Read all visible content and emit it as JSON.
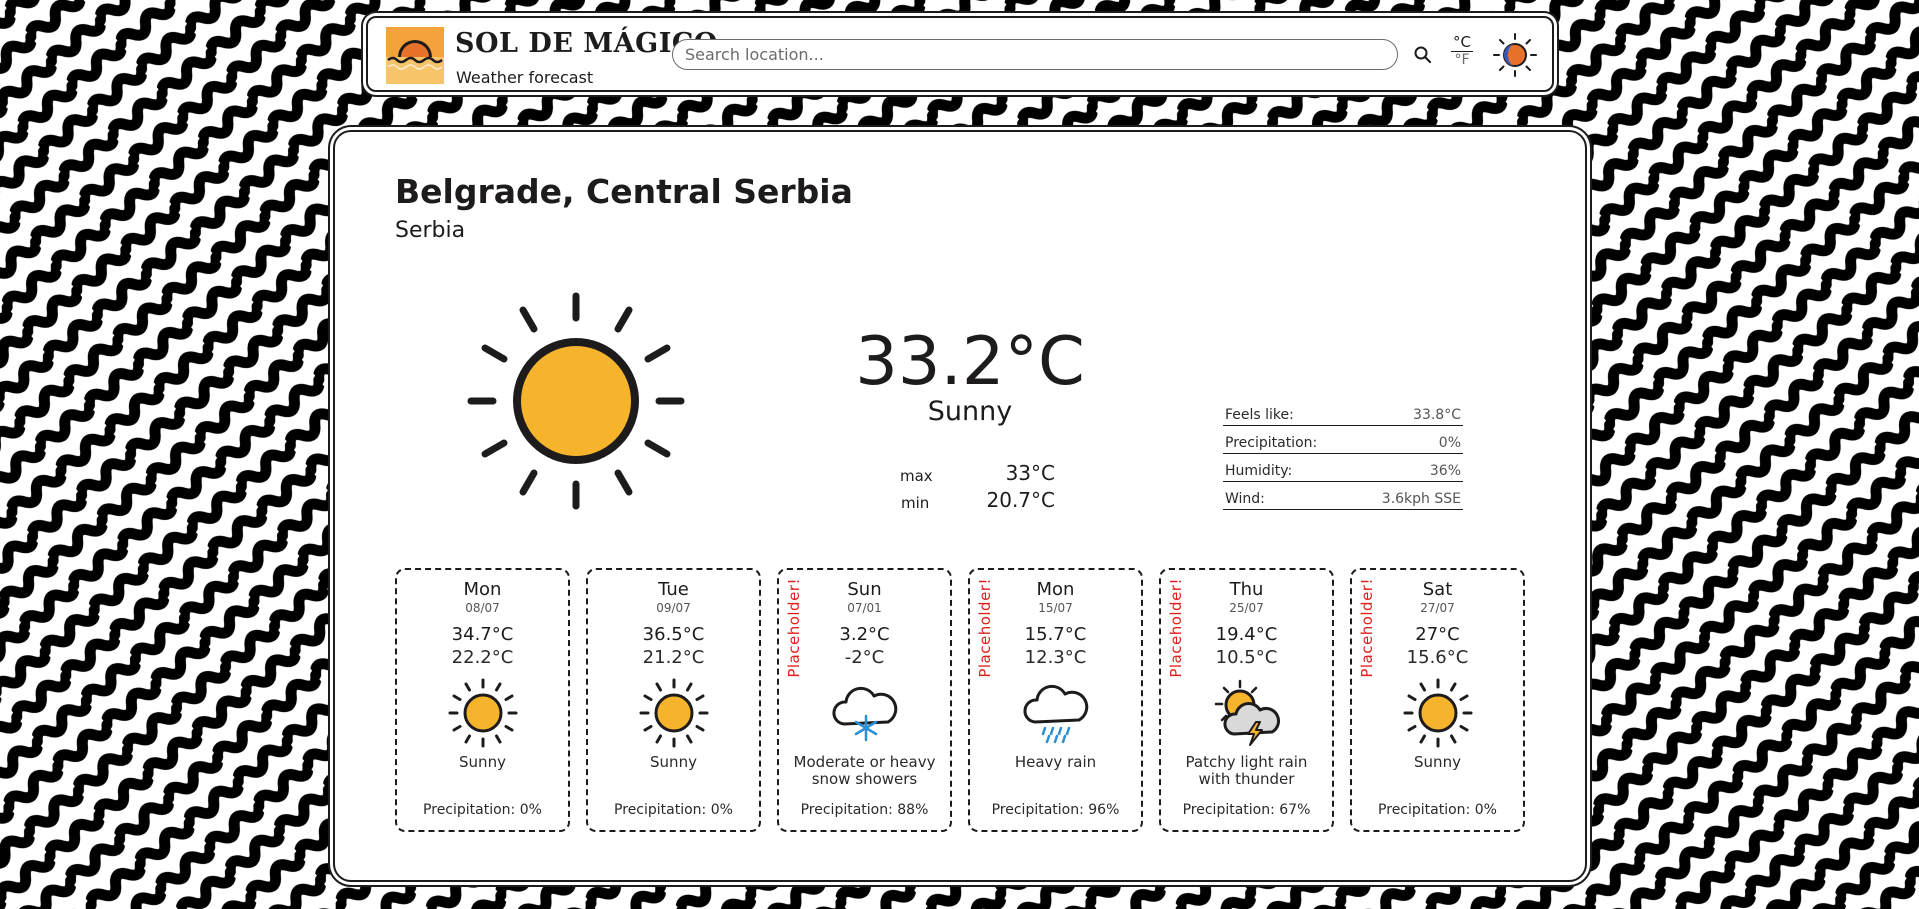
{
  "brand": {
    "title": "SOL DE MÁGICO",
    "subtitle": "Weather forecast"
  },
  "search": {
    "placeholder": "Search location..."
  },
  "units": {
    "celsius": "°C",
    "fahrenheit": "°F"
  },
  "location": {
    "city": "Belgrade, Central Serbia",
    "country": "Serbia"
  },
  "current": {
    "temperature": "33.2°C",
    "condition": "Sunny",
    "icon": "sun-icon",
    "max_label": "max",
    "max": "33°C",
    "min_label": "min",
    "min": "20.7°C"
  },
  "details": [
    {
      "label": "Feels like:",
      "value": "33.8°C"
    },
    {
      "label": "Precipitation:",
      "value": "0%"
    },
    {
      "label": "Humidity:",
      "value": "36%"
    },
    {
      "label": "Wind:",
      "value": "3.6kph SSE"
    }
  ],
  "forecast": [
    {
      "day": "Mon",
      "date": "08/07",
      "max": "34.7°C",
      "min": "22.2°C",
      "condition": "Sunny",
      "icon": "sun-icon",
      "precipitation": "Precipitation: 0%",
      "placeholder": ""
    },
    {
      "day": "Tue",
      "date": "09/07",
      "max": "36.5°C",
      "min": "21.2°C",
      "condition": "Sunny",
      "icon": "sun-icon",
      "precipitation": "Precipitation: 0%",
      "placeholder": ""
    },
    {
      "day": "Sun",
      "date": "07/01",
      "max": "3.2°C",
      "min": "-2°C",
      "condition": "Moderate or heavy snow showers",
      "icon": "snow-cloud-icon",
      "precipitation": "Precipitation: 88%",
      "placeholder": "Placeholder!"
    },
    {
      "day": "Mon",
      "date": "15/07",
      "max": "15.7°C",
      "min": "12.3°C",
      "condition": "Heavy rain",
      "icon": "rain-cloud-icon",
      "precipitation": "Precipitation: 96%",
      "placeholder": "Placeholder!"
    },
    {
      "day": "Thu",
      "date": "25/07",
      "max": "19.4°C",
      "min": "10.5°C",
      "condition": "Patchy light rain with thunder",
      "icon": "thunder-sun-cloud-icon",
      "precipitation": "Precipitation: 67%",
      "placeholder": "Placeholder!"
    },
    {
      "day": "Sat",
      "date": "27/07",
      "max": "27°C",
      "min": "15.6°C",
      "condition": "Sunny",
      "icon": "sun-icon",
      "precipitation": "Precipitation: 0%",
      "placeholder": "Placeholder!"
    }
  ],
  "colors": {
    "sun": "#f6b42d",
    "ink": "#1e1b1c",
    "placeholder": "#e0201c",
    "logo_bg": "#f3a23c",
    "snowflake": "#2a8fd4"
  }
}
